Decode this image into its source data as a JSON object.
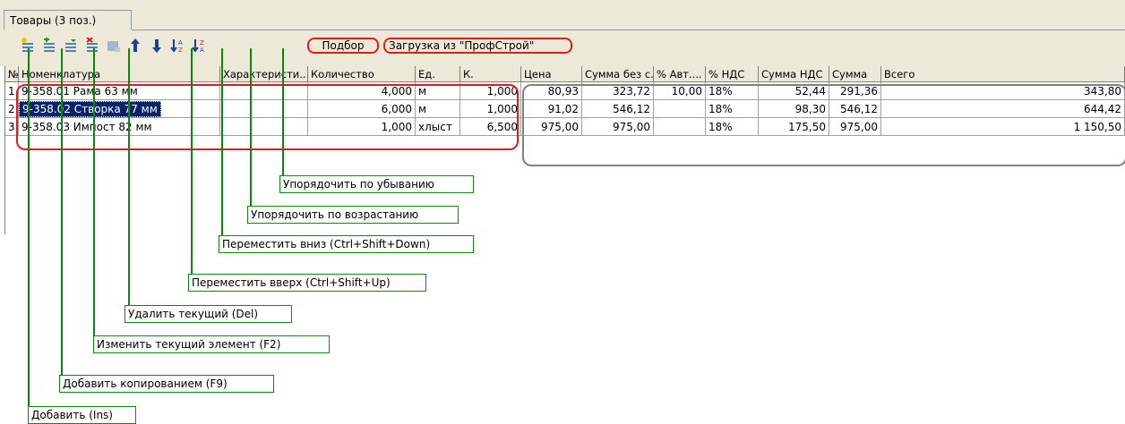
{
  "tab": {
    "label": "Товары (3 поз.)"
  },
  "toolbar": {
    "icons": [
      "add-icon",
      "add-copy-icon",
      "edit-icon",
      "delete-icon",
      "disabled-icon",
      "move-up-icon",
      "move-down-icon",
      "sort-ascending-icon",
      "sort-descending-icon"
    ],
    "podbor_label": "Подбор",
    "zagruzka_label": "Загрузка из \"ПрофСтрой\""
  },
  "table": {
    "headers": [
      "№",
      "Номенклатура",
      "Характеристи...",
      "Количество",
      "Ед.",
      "К.",
      "Цена",
      "Сумма без с...",
      "% Авт....",
      "% НДС",
      "Сумма НДС",
      "Сумма",
      "Всего"
    ],
    "rows": [
      [
        "1",
        "9-358.01 Рама 63 мм",
        "",
        "4,000",
        "м",
        "1,000",
        "80,93",
        "323,72",
        "10,00",
        "18%",
        "52,44",
        "291,36",
        "343,80"
      ],
      [
        "2",
        "9-358.02 Створка 77 мм",
        "",
        "6,000",
        "м",
        "1,000",
        "91,02",
        "546,12",
        "",
        "18%",
        "98,30",
        "546,12",
        "644,42"
      ],
      [
        "3",
        "9-358.03 Импост 82 мм",
        "",
        "1,000",
        "хлыст",
        "6,500",
        "975,00",
        "975,00",
        "",
        "18%",
        "175,50",
        "975,00",
        "1 150,50"
      ]
    ]
  },
  "callouts": {
    "add": "Добавить (Ins)",
    "add_copy": "Добавить копированием (F9)",
    "edit": "Изменить текущий элемент (F2)",
    "delete": "Удалить текущий (Del)",
    "move_up": "Переместить вверх (Ctrl+Shift+Up)",
    "move_down": "Переместить вниз (Ctrl+Shift+Down)",
    "sort_asc": "Упорядочить по возрастанию",
    "sort_desc": "Упорядочить по убыванию"
  },
  "colors": {
    "annotation_red": "#e21b1b",
    "annotation_green": "#0a8a0a",
    "selection": "#0a246a",
    "chrome": "#ece9d8"
  }
}
